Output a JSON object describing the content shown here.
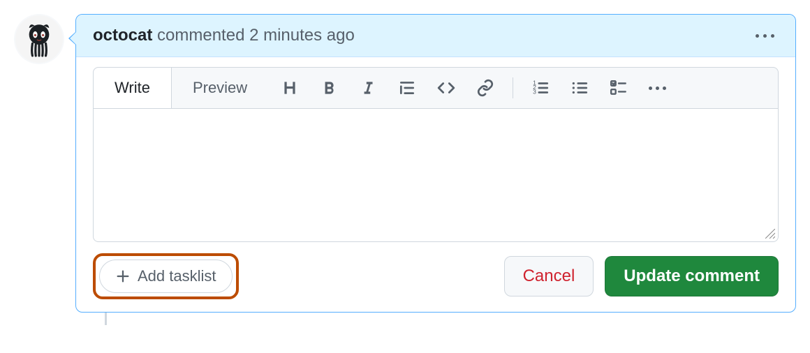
{
  "header": {
    "author": "octocat",
    "meta_text": "commented 2 minutes ago"
  },
  "editor": {
    "tabs": {
      "write": "Write",
      "preview": "Preview"
    },
    "textarea_value": "",
    "textarea_placeholder": ""
  },
  "toolbar_icons": {
    "heading": "heading-icon",
    "bold": "bold-icon",
    "italic": "italic-icon",
    "quote": "quote-icon",
    "code": "code-icon",
    "link": "link-icon",
    "ordered_list": "ordered-list-icon",
    "unordered_list": "unordered-list-icon",
    "task_list": "task-list-icon",
    "more": "more-icon"
  },
  "actions": {
    "add_tasklist": "Add tasklist",
    "cancel": "Cancel",
    "update": "Update comment"
  },
  "colors": {
    "header_bg": "#ddf4ff",
    "border_accent": "#54aeff",
    "highlight": "#bc4c00",
    "primary_btn": "#1f883d",
    "danger_text": "#cf222e"
  }
}
